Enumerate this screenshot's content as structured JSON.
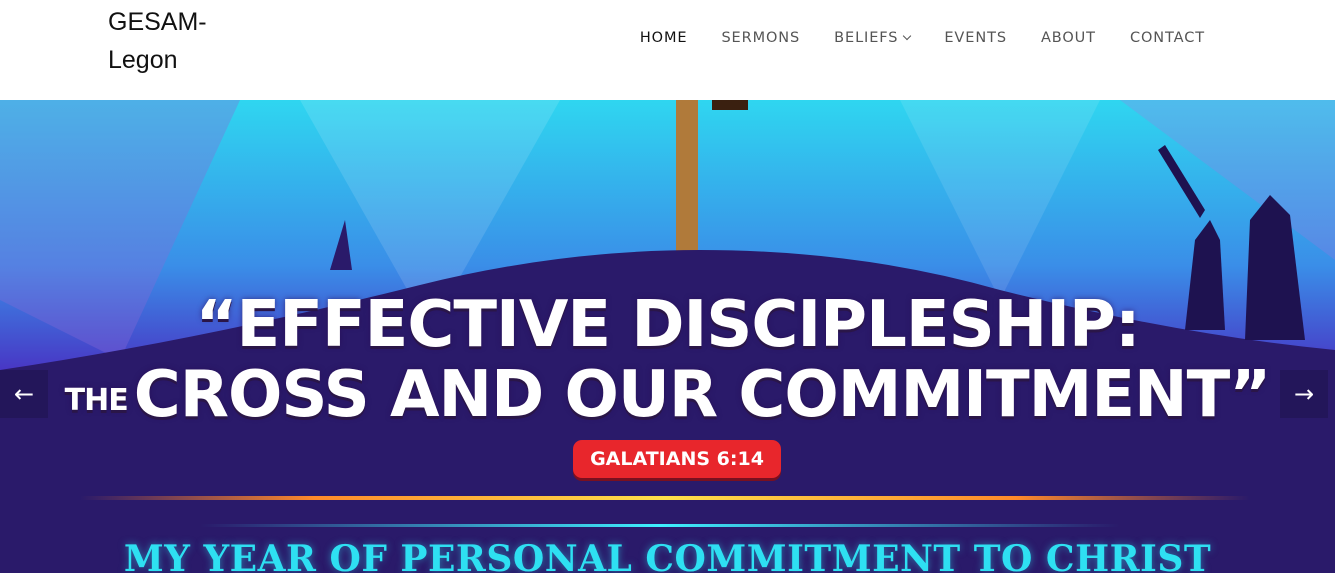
{
  "header": {
    "site_title_line1": "GESAM-",
    "site_title_line2": "Legon"
  },
  "nav": {
    "items": [
      {
        "label": "HOME",
        "active": true
      },
      {
        "label": "SERMONS"
      },
      {
        "label": "BELIEFS",
        "has_submenu": true
      },
      {
        "label": "EVENTS"
      },
      {
        "label": "ABOUT"
      },
      {
        "label": "CONTACT"
      }
    ]
  },
  "hero": {
    "line1": "“EFFECTIVE DISCIPLESHIP:",
    "line2_small": "THE",
    "line2": "CROSS AND OUR COMMITMENT”",
    "verse": "GALATIANS 6:14",
    "motto": "MY YEAR OF PERSONAL COMMITMENT TO CHRIST",
    "prev_icon": "arrow-left-icon",
    "next_icon": "arrow-right-icon"
  },
  "colors": {
    "sky_top": "#2fd6f0",
    "sky_bottom": "#3a0f8a",
    "verse_badge": "#e8262c",
    "motto_text": "#2ee0f2",
    "nav_active": "#111111",
    "nav_text": "#555555"
  }
}
